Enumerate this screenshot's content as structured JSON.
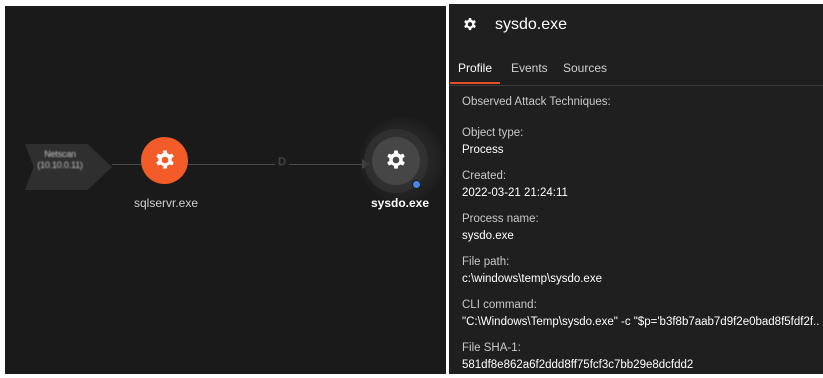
{
  "graph": {
    "entry_node": {
      "line1": "Netscan",
      "line2": "(10.10.0.11)"
    },
    "edge_label": "D",
    "nodes": [
      {
        "label": "sqlservr.exe",
        "icon": "gear-icon",
        "color": "#f35c28"
      },
      {
        "label": "sysdo.exe",
        "icon": "gear-icon",
        "color": "#464646",
        "status_color": "#4a86e8"
      }
    ]
  },
  "panel": {
    "title": "sysdo.exe",
    "tabs": [
      {
        "label": "Profile",
        "active": true
      },
      {
        "label": "Events",
        "active": false
      },
      {
        "label": "Sources",
        "active": false
      }
    ],
    "fields": [
      {
        "label": "Observed Attack Techniques:",
        "value": ""
      },
      {
        "label": "Object type:",
        "value": "Process"
      },
      {
        "label": "Created:",
        "value": "2022-03-21 21:24:11"
      },
      {
        "label": "Process name:",
        "value": "sysdo.exe"
      },
      {
        "label": "File path:",
        "value": "c:\\windows\\temp\\sysdo.exe"
      },
      {
        "label": "CLI command:",
        "value": "\"C:\\Windows\\Temp\\sysdo.exe\" -c \"$p='b3f8b7aab7d9f2e0bad8f5fdf2f..."
      },
      {
        "label": "File SHA-1:",
        "value": "581df8e862a6f2ddd8ff75fcf3c7bb29e8dcfdd2"
      }
    ]
  },
  "colors": {
    "accent": "#e0502b",
    "background": "#1a1a1a",
    "panel": "#1f1f1f"
  }
}
